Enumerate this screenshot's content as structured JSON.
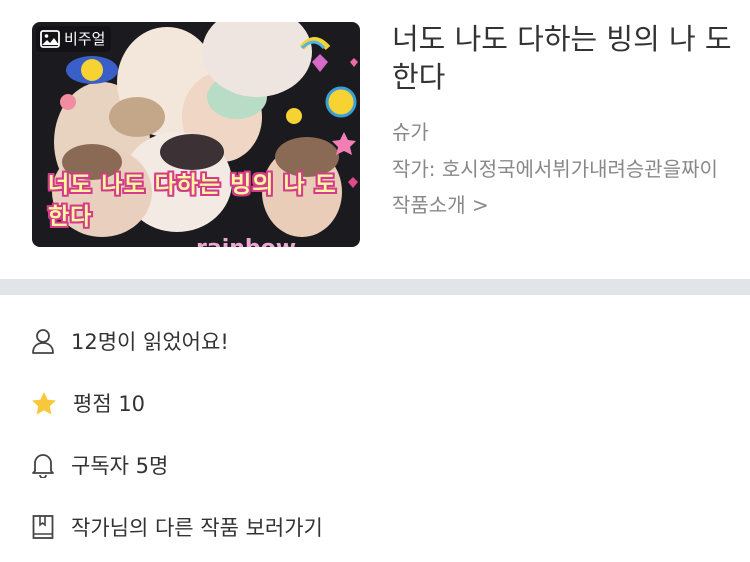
{
  "cover": {
    "badge_label": "비주얼",
    "caption": "너도 나도 다하는 빙의 나 도 한다",
    "sticker_text": "rainbow"
  },
  "work": {
    "title": "너도 나도 다하는 빙의 나 도 한다",
    "subtitle": "슈가",
    "author_line": "작가: 호시정국에서뷔가내려승관을짜이",
    "intro_link": "작품소개 >"
  },
  "stats": {
    "readers": "12명이 읽었어요!",
    "rating": "평점 10",
    "subscribers": "구독자 5명",
    "other_works": "작가님의 다른 작품 보러가기"
  },
  "icons": {
    "badge": "image-icon",
    "readers": "person-icon",
    "rating": "star-icon",
    "subscribers": "bell-icon",
    "other_works": "book-icon"
  },
  "colors": {
    "divider": "#e1e4e8",
    "star": "#f7c93a",
    "secondary_text": "#888888"
  }
}
